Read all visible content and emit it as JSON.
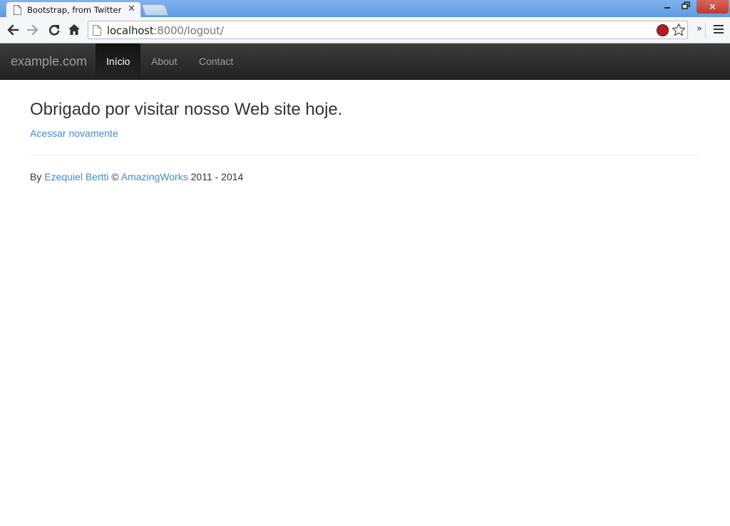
{
  "browser": {
    "tab_title": "Bootstrap, from Twitter",
    "tab_close": "✕",
    "url_host": "localhost",
    "url_path": ":8000/logout/",
    "window_close": "✕"
  },
  "navbar": {
    "brand": "example.com",
    "items": [
      {
        "label": "Início",
        "active": true
      },
      {
        "label": "About",
        "active": false
      },
      {
        "label": "Contact",
        "active": false
      }
    ]
  },
  "main": {
    "heading": "Obrigado por visitar nosso Web site hoje.",
    "login_again_link": "Acessar novamente"
  },
  "footer": {
    "prefix": "By ",
    "author": "Ezequiel Bertti",
    "copyright": " © ",
    "company": "AmazingWorks",
    "years": " 2011 - 2014"
  },
  "colors": {
    "navbar_bg": "#222222",
    "link": "#428bca",
    "titlebar": "#6fa8e8",
    "close_button": "#c84b3f"
  }
}
